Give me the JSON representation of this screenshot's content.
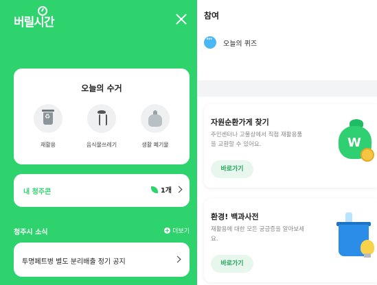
{
  "app": {
    "brand": "버릴시간"
  },
  "menu": {
    "collect": {
      "title": "오늘의 수거",
      "categories": [
        {
          "label": "재활용",
          "icon": "recycle-bin-icon"
        },
        {
          "label": "음식물쓰레기",
          "icon": "food-waste-icon"
        },
        {
          "label": "생활 폐기물",
          "icon": "trash-bag-icon"
        }
      ]
    },
    "coupon": {
      "label": "내 청주콘",
      "count": "1개"
    },
    "news": {
      "title": "청주시 소식",
      "more": "더보기",
      "notice": "투명페트병 별도 분리배출 정기 공지"
    }
  },
  "participate": {
    "title": "참여",
    "quiz": "오늘의 퀴즈",
    "cards": [
      {
        "title": "자원순환가게 찾기",
        "desc": "주민센터나 고물상에서 직접 재활용품을 교환할 수 있어요.",
        "button": "바로가기",
        "image": "money-bag-icon"
      },
      {
        "title": "환경! 백과사전",
        "desc": "재활용에 대한 모든 궁금증을 알아보세요.",
        "button": "바로가기",
        "image": "recycle-bin-lightbulb-icon"
      }
    ]
  },
  "colors": {
    "brand_green": "#2fd36e",
    "quiz_blue": "#49b8f5"
  }
}
